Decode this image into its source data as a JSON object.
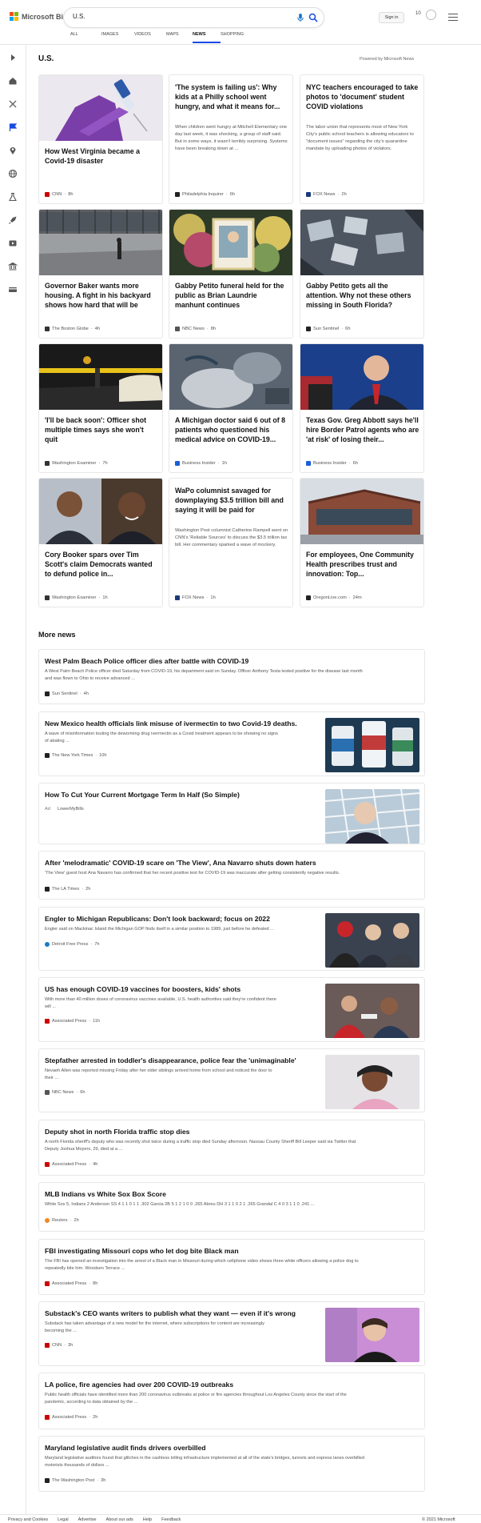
{
  "header": {
    "logo_text": "Microsoft Bing",
    "search_value": "U.S.",
    "nav": [
      "ALL",
      "IMAGES",
      "VIDEOS",
      "MAPS",
      "NEWS",
      "SHOPPING"
    ],
    "active_nav": "NEWS",
    "signin_label": "Sign in",
    "rewards_count": "10"
  },
  "main": {
    "topic_title": "U.S.",
    "powered_by": "Powered by Microsoft News",
    "more_news_title": "More news"
  },
  "cards": [
    {
      "title": "How West Virginia became a Covid-19 disaster",
      "source": "CNN",
      "time": "8h",
      "source_color": "#cc0000"
    },
    {
      "title": "'The system is failing us': Why kids at a Philly school went hungry, and what it means for...",
      "desc": "When children went hungry at Mitchell Elementary one day last week, it was shocking, a group of staff said. But in some ways, it wasn't terribly surprising. Systems have been breaking down at ...",
      "source": "Philadelphia Inquirer",
      "time": "6h",
      "source_color": "#222222"
    },
    {
      "title": "NYC teachers encouraged to take photos to 'document' student COVID violations",
      "desc": "The labor union that represents most of New York City's public school teachers is allowing educators to \"document issues\" regarding the city's quarantine mandate by uploading photos of violators.",
      "source": "FOX News",
      "time": "2h",
      "source_color": "#1b3a7a"
    },
    {
      "title": "Governor Baker wants more housing. A fight in his backyard shows how hard that will be",
      "source": "The Boston Globe",
      "time": "4h",
      "source_color": "#333333"
    },
    {
      "title": "Gabby Petito funeral held for the public as Brian Laundrie manhunt continues",
      "source": "NBC News",
      "time": "8h",
      "source_color": "#555555"
    },
    {
      "title": "Gabby Petito gets all the attention. Why not these others missing in South Florida?",
      "source": "Sun Sentinel",
      "time": "6h",
      "source_color": "#222222"
    },
    {
      "title": "'I'll be back soon': Officer shot multiple times says she won't quit",
      "source": "Washington Examiner",
      "time": "7h",
      "source_color": "#333333"
    },
    {
      "title": "A Michigan doctor said 6 out of 8 patients who questioned his medical advice on COVID-19...",
      "source": "Business Insider",
      "time": "1h",
      "source_color": "#1a5fd6"
    },
    {
      "title": "Texas Gov. Greg Abbott says he'll hire Border Patrol agents who are 'at risk' of losing their...",
      "source": "Business Insider",
      "time": "6h",
      "source_color": "#1a5fd6"
    },
    {
      "title": "Cory Booker spars over Tim Scott's claim Democrats wanted to defund police in...",
      "source": "Washington Examiner",
      "time": "1h",
      "source_color": "#333333"
    },
    {
      "title": "WaPo columnist savaged for downplaying $3.5 trillion bill and saying it will be paid for",
      "desc": "Washington Post columnist Catherine Rampell went on CNN's 'Reliable Sources' to discuss the $3.5 trillion tax bill. Her commentary sparked a wave of mockery.",
      "source": "FOX News",
      "time": "1h",
      "source_color": "#1b3a7a"
    },
    {
      "title": "For employees, One Community Health prescribes trust and innovation: Top...",
      "source": "OregonLive.com",
      "time": "24m",
      "source_color": "#222222"
    }
  ],
  "news": [
    {
      "title": "West Palm Beach Police officer dies after battle with COVID-19",
      "desc": [
        "A West Palm Beach Police officer died Saturday from COVID-19, his department said on Sunday. Officer Anthony Testa tested positive for the disease last month",
        "and was flown to Ohio to receive advanced ..."
      ],
      "source": "Sun Sentinel",
      "time": "4h",
      "source_color": "#222222"
    },
    {
      "title": "New Mexico health officials link misuse of ivermectin to two Covid-19 deaths.",
      "desc": [
        "A wave of misinformation touting the deworming drug ivermectin as a Covid treatment appears to be showing no signs",
        "of abating ..."
      ],
      "source": "The New York Times",
      "time": "10h",
      "source_color": "#222222"
    },
    {
      "title": "How To Cut Your Current Mortgage Term In Half (So Simple)",
      "desc": [],
      "ad": "Ad",
      "source": "LowerMyBills",
      "time": "",
      "source_color": "#ffffff"
    },
    {
      "title": "After 'melodramatic' COVID-19 scare on 'The View', Ana Navarro shuts down haters",
      "desc": [
        "'The View' guest host Ana Navarro has confirmed that her recent positive test for COVID-19 was inaccurate after getting consistently negative results."
      ],
      "source": "The LA Times",
      "time": "2h",
      "source_color": "#222222"
    },
    {
      "title": "Engler to Michigan Republicans: Don't look backward; focus on 2022",
      "desc": [
        "Engler said on Mackinac Island the Michigan GOP finds itself in a similar position to 1989, just before he defeated ..."
      ],
      "source": "Detroit Free Press",
      "time": "7h",
      "source_color": "#1a7cc2"
    },
    {
      "title": "US has enough COVID-19 vaccines for boosters, kids' shots",
      "desc": [
        "With more than 40 million doses of coronavirus vaccines available, U.S. health authorities said they're confident there",
        "will ..."
      ],
      "source": "Associated Press",
      "time": "11h",
      "source_color": "#d00000"
    },
    {
      "title": "Stepfather arrested in toddler's disappearance, police fear the 'unimaginable'",
      "desc": [
        "Nevaeh Allen was reported missing Friday after her older siblings arrived home from school and noticed the door to",
        "their ..."
      ],
      "source": "NBC News",
      "time": "6h",
      "source_color": "#555555"
    },
    {
      "title": "Deputy shot in north Florida traffic stop dies",
      "desc": [
        "A north Florida sheriff's deputy who was recently shot twice during a traffic stop died Sunday afternoon. Nassau County Sheriff Bill Leeper said via Twitter that",
        "Deputy Joshua Moyers, 29, died at a ..."
      ],
      "source": "Associated Press",
      "time": "4h",
      "source_color": "#d00000"
    },
    {
      "title": "MLB Indians vs White Sox Box Score",
      "desc": [
        "White Sox 5, Indians 2 Anderson SS 4 1 1 0 1 1 .302 Garcia 2B 5 1 2 1 0 0 .265 Abreu DH 3 1 1 0 2 1 .265 Grandal C 4 0 3 1 1 0 .241 ..."
      ],
      "source": "Reuters",
      "time": "2h",
      "source_color": "#f08a24"
    },
    {
      "title": "FBI investigating Missouri cops who let dog bite Black man",
      "desc": [
        "The FBI has opened an investigation into the arrest of a Black man in Missouri during which cellphone video shows three white officers allowing a police dog to",
        "repeatedly bite him. Woodsen Terrace ..."
      ],
      "source": "Associated Press",
      "time": "8h",
      "source_color": "#d00000"
    },
    {
      "title": "Substack's CEO wants writers to publish what they want — even if it's wrong",
      "desc": [
        "Substack has taken advantage of a new model for the internet, where subscriptions for content are increasingly",
        "becoming the ..."
      ],
      "source": "CNN",
      "time": "3h",
      "source_color": "#cc0000"
    },
    {
      "title": "LA police, fire agencies had over 200 COVID-19 outbreaks",
      "desc": [
        "Public health officials have identified more than 200 coronavirus outbreaks at police or fire agencies throughout Los Angeles County since the start of the",
        "pandemic, according to data obtained by the ..."
      ],
      "source": "Associated Press",
      "time": "2h",
      "source_color": "#d00000"
    },
    {
      "title": "Maryland legislative audit finds drivers overbilled",
      "desc": [
        "Maryland legislative auditors found that glitches in the cashless tolling infrastructure implemented at all of the state's bridges, tunnels and express lanes overbilled",
        "motorists thousands of dollars ..."
      ],
      "source": "The Washington Post",
      "time": "3h",
      "source_color": "#222222"
    }
  ],
  "footer": {
    "links": [
      "Privacy and Cookies",
      "Legal",
      "Advertise",
      "About our ads",
      "Help",
      "Feedback"
    ],
    "copyright": "© 2021 Microsoft"
  }
}
